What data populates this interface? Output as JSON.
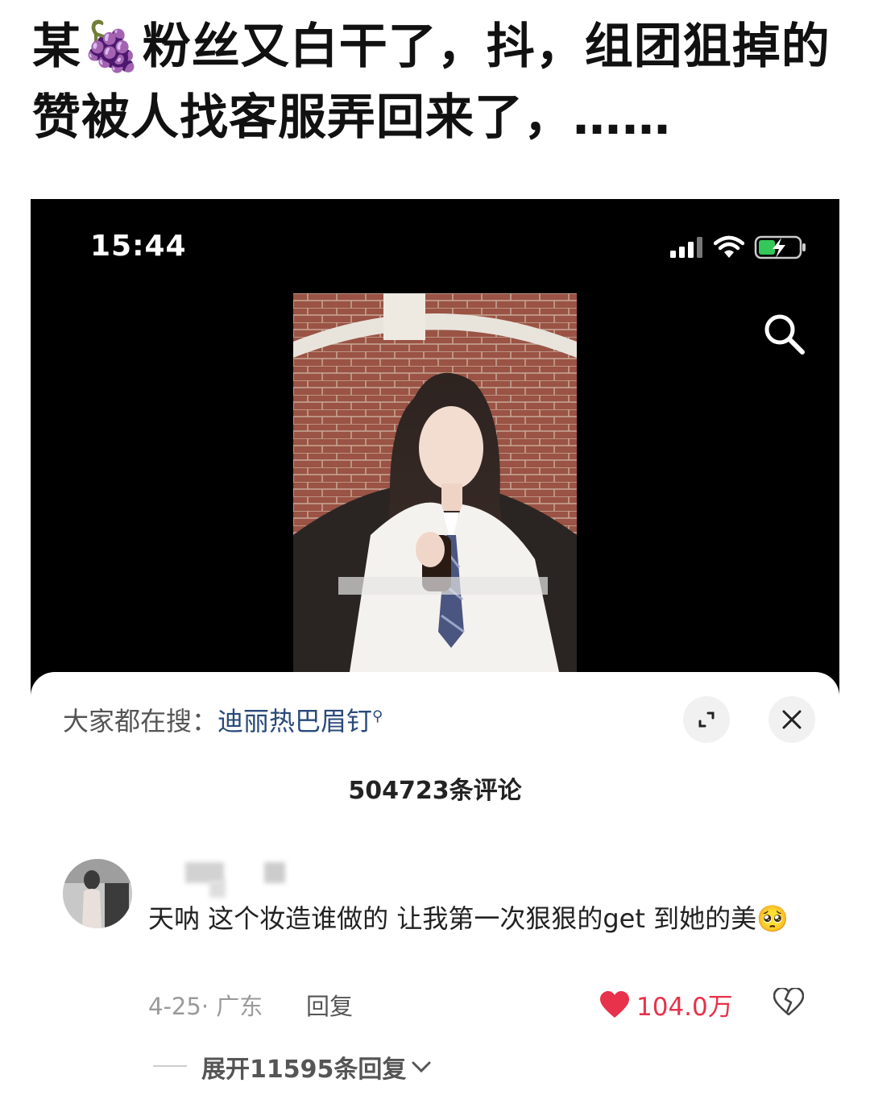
{
  "post": {
    "title_before_emoji": "某",
    "grape_emoji": "🍇",
    "title_after_emoji": "粉丝又白干了，抖，组团狙掉的赞被人找客服弄回来了，……"
  },
  "status_bar": {
    "time": "15:44",
    "icons": [
      "signal-icon",
      "wifi-icon",
      "battery-charging-icon"
    ]
  },
  "top_bar": {
    "search_icon": "search-icon"
  },
  "comment_sheet": {
    "hot_search_label": "大家都在搜：",
    "hot_search_keyword": "迪丽热巴眉钉",
    "hot_search_icon": "search-small-icon",
    "fullscreen_icon": "expand-icon",
    "close_icon": "close-icon",
    "comment_count": "504723条评论",
    "comments": [
      {
        "text": "天呐 这个妆造谁做的 让我第一次狠狠的get 到她的美🥺",
        "date_location": "4-25· 广东",
        "reply_label": "回复",
        "like_count": "104.0万",
        "like_icon": "heart-filled-icon",
        "dislike_icon": "broken-heart-icon",
        "expand_replies": "展开11595条回复"
      }
    ]
  },
  "colors": {
    "like_red": "#e8314b",
    "keyword_blue": "#2a4a7a",
    "sheet_bg": "#ffffff",
    "video_bg": "#000000"
  }
}
